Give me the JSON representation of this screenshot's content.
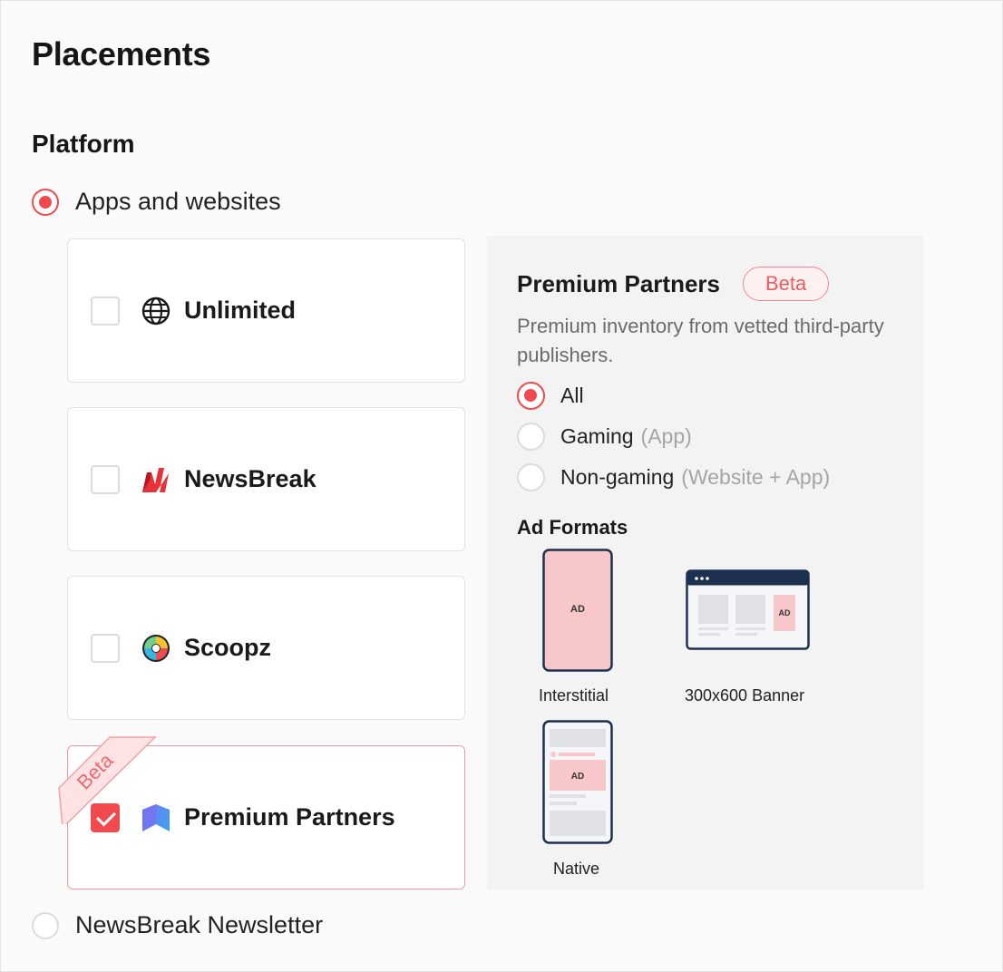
{
  "page": {
    "title": "Placements"
  },
  "platform": {
    "title": "Platform",
    "options": [
      {
        "label": "Apps and websites",
        "selected": true
      },
      {
        "label": "NewsBreak Newsletter",
        "selected": false
      }
    ]
  },
  "cards": [
    {
      "label": "Unlimited",
      "checked": false,
      "icon": "globe-icon"
    },
    {
      "label": "NewsBreak",
      "checked": false,
      "icon": "newsbreak-logo-icon"
    },
    {
      "label": "Scoopz",
      "checked": false,
      "icon": "scoopz-logo-icon"
    },
    {
      "label": "Premium Partners",
      "checked": true,
      "icon": "premium-partners-logo-icon",
      "ribbon": "Beta"
    }
  ],
  "panel": {
    "title": "Premium Partners",
    "badge": "Beta",
    "description": "Premium inventory from vetted third-party publishers.",
    "options": [
      {
        "label": "All",
        "sub": "",
        "selected": true
      },
      {
        "label": "Gaming",
        "sub": "(App)",
        "selected": false
      },
      {
        "label": "Non-gaming",
        "sub": "(Website + App)",
        "selected": false
      }
    ],
    "ad_formats_title": "Ad Formats",
    "formats": [
      {
        "caption": "Interstitial",
        "ad_text": "AD"
      },
      {
        "caption": "300x600 Banner",
        "ad_text": "AD"
      },
      {
        "caption": "Native",
        "ad_text": "AD"
      }
    ]
  },
  "colors": {
    "accent": "#f04a4f",
    "navy": "#1e3050",
    "ad_pink": "#f8c7c9"
  }
}
